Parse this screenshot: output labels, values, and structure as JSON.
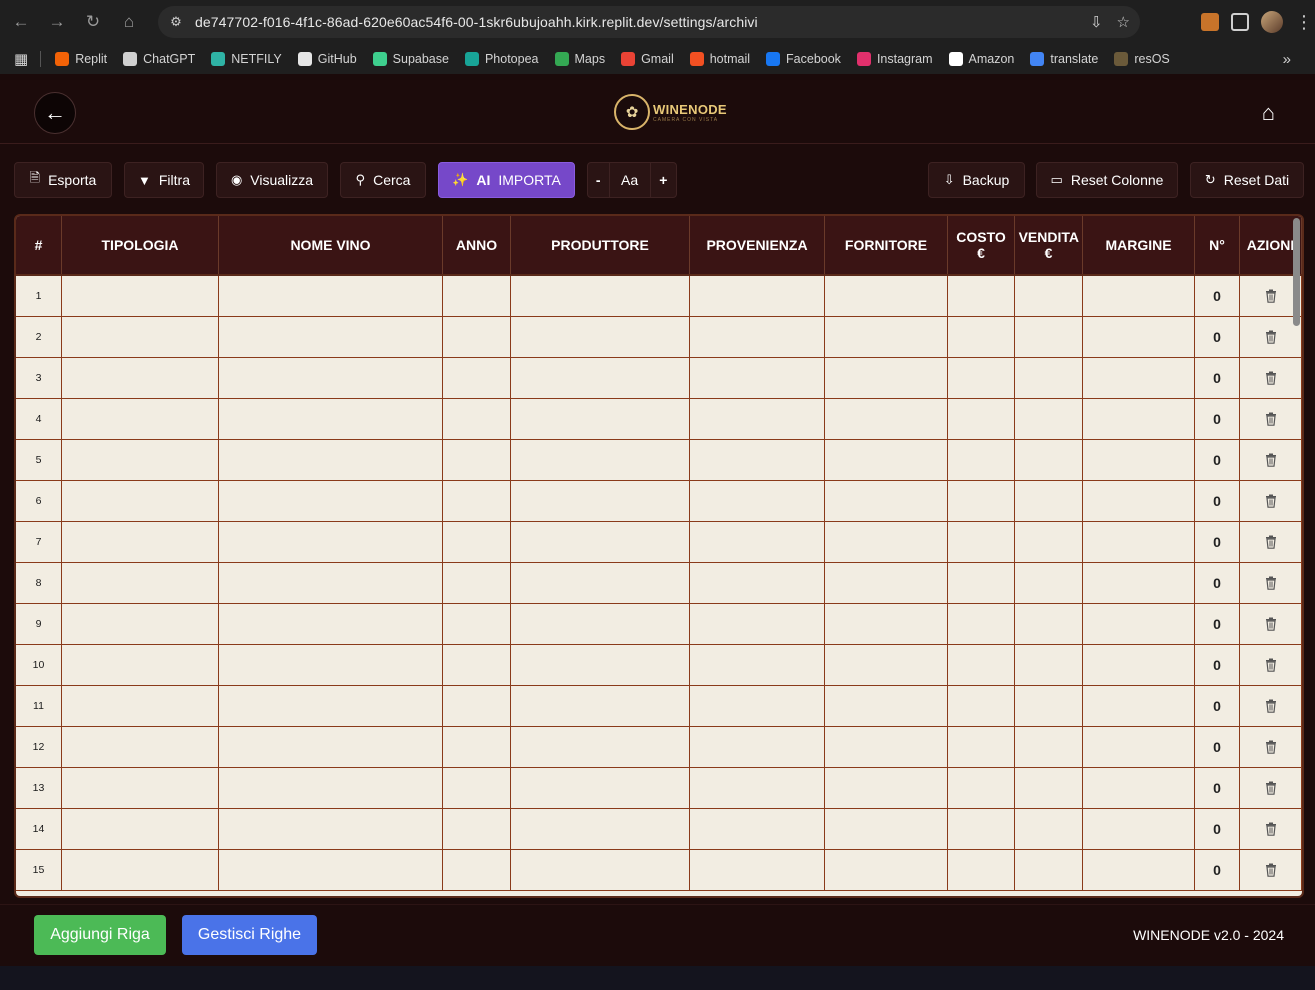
{
  "browser": {
    "url": "de747702-f016-4f1c-86ad-620e60ac54f6-00-1skr6ubujoahh.kirk.replit.dev/settings/archivi",
    "bookmarks": [
      {
        "label": "Replit",
        "color": "#f26207"
      },
      {
        "label": "ChatGPT",
        "color": "#d0d0d0"
      },
      {
        "label": "NETFILY",
        "color": "#2fb3a5"
      },
      {
        "label": "GitHub",
        "color": "#e6e6e6"
      },
      {
        "label": "Supabase",
        "color": "#3ecf8e"
      },
      {
        "label": "Photopea",
        "color": "#18a497"
      },
      {
        "label": "Maps",
        "color": "#34a853"
      },
      {
        "label": "Gmail",
        "color": "#ea4335"
      },
      {
        "label": "hotmail",
        "color": "#f25022"
      },
      {
        "label": "Facebook",
        "color": "#1877f2"
      },
      {
        "label": "Instagram",
        "color": "#e1306c"
      },
      {
        "label": "Amazon",
        "color": "#ffffff"
      },
      {
        "label": "translate",
        "color": "#4285f4"
      },
      {
        "label": "resOS",
        "color": "#6b5a3a"
      }
    ]
  },
  "header": {
    "logo_name": "WINENODE",
    "logo_sub": "CAMERA CON VISTA"
  },
  "toolbar": {
    "export": "Esporta",
    "filter": "Filtra",
    "view": "Visualizza",
    "search": "Cerca",
    "ai_label": "AI",
    "ai_import": "IMPORTA",
    "font_minus": "-",
    "font_aa": "Aa",
    "font_plus": "+",
    "backup": "Backup",
    "reset_columns": "Reset Colonne",
    "reset_data": "Reset Dati"
  },
  "table": {
    "columns": [
      "#",
      "TIPOLOGIA",
      "NOME VINO",
      "ANNO",
      "PRODUTTORE",
      "PROVENIENZA",
      "FORNITORE",
      "COSTO €",
      "VENDITA €",
      "MARGINE",
      "N°",
      "AZIONI"
    ],
    "rows": [
      {
        "index": "1",
        "qty": "0"
      },
      {
        "index": "2",
        "qty": "0"
      },
      {
        "index": "3",
        "qty": "0"
      },
      {
        "index": "4",
        "qty": "0"
      },
      {
        "index": "5",
        "qty": "0"
      },
      {
        "index": "6",
        "qty": "0"
      },
      {
        "index": "7",
        "qty": "0"
      },
      {
        "index": "8",
        "qty": "0"
      },
      {
        "index": "9",
        "qty": "0"
      },
      {
        "index": "10",
        "qty": "0"
      },
      {
        "index": "11",
        "qty": "0"
      },
      {
        "index": "12",
        "qty": "0"
      },
      {
        "index": "13",
        "qty": "0"
      },
      {
        "index": "14",
        "qty": "0"
      },
      {
        "index": "15",
        "qty": "0"
      }
    ]
  },
  "footer": {
    "add_row": "Aggiungi Riga",
    "manage_rows": "Gestisci Righe",
    "version": "WINENODE v2.0 - 2024"
  },
  "colors": {
    "accent_ai": "#7648c9",
    "add_green": "#4cba56",
    "manage_blue": "#4a73e8",
    "table_header": "#3a1414",
    "table_bg": "#f2ede2"
  }
}
